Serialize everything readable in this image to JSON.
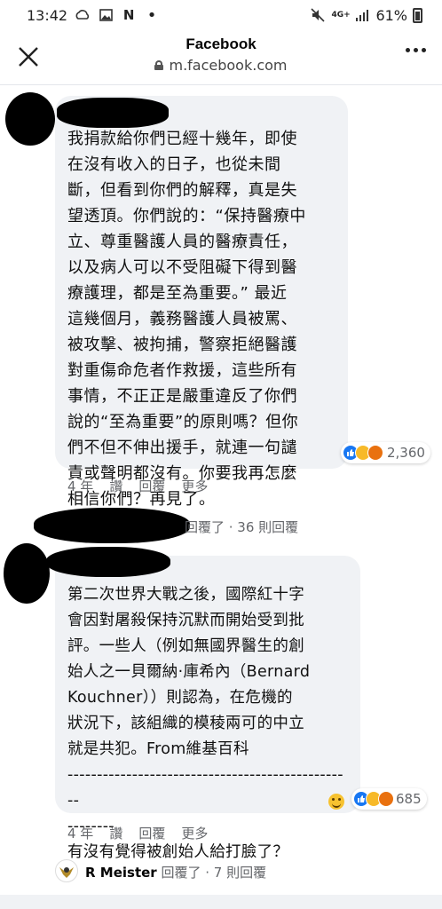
{
  "status_bar": {
    "time": "13:42",
    "battery": "61%",
    "network": "4G+"
  },
  "header": {
    "title": "Facebook",
    "url": "m.facebook.com"
  },
  "comment1": {
    "text": "我捐款給你們已經十幾年，即使\n在沒有收入的日子，也從未間\n斷，但看到你們的解釋，真是失\n望透頂。你們說的：“保持醫療中\n立、尊重醫護人員的醫療責任，\n以及病人可以不受阻礙下得到醫\n療護理，都是至為重要。” 最近\n這幾個月，義務醫護人員被罵、\n被攻擊、被拘捕，警察拒絕醫護\n對重傷命危者作救援，這些所有\n事情，不正正是嚴重違反了你們\n說的“至為重要”的原則嗎？但你\n們不但不伸出援手，就連一句譴\n責或聲明都沒有。你要我再怎麼\n相信你們？再見了。",
    "reaction_count": "2,360",
    "actions": {
      "time": "4 年",
      "like": "讚",
      "reply": "回覆",
      "more": "更多"
    },
    "reply_summary": "回覆了 · 36 則回覆"
  },
  "comment2": {
    "text": "第二次世界大戰之後，國際紅十字\n會因對屠殺保持沉默而開始受到批\n評。一些人（例如無國界醫生的創\n始人之一貝爾納·庫希內（Bernard\nKouchner））則認為，在危機的\n狀況下，該組織的模稜兩可的中立\n就是共犯。From維基百科\n-------------------------------------------------\n--------\n有沒有覺得被創始人給打臉了？",
    "reaction_count": "685",
    "actions": {
      "time": "4 年",
      "like": "讚",
      "reply": "回覆",
      "more": "更多"
    }
  },
  "reply_preview": {
    "author": "R Meister",
    "text": " 回覆了 · 7 則回覆"
  },
  "colors": {
    "bubble": "#f0f2f5",
    "meta_text": "#65676b",
    "like_blue": "#1877f2"
  }
}
